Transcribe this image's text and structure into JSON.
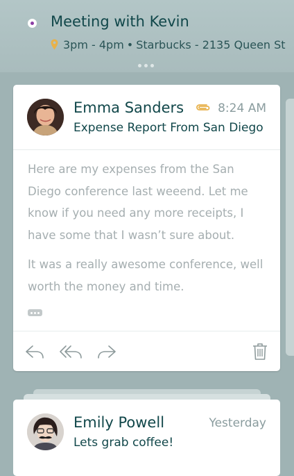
{
  "event": {
    "title": "Meeting with Kevin",
    "time": "3pm - 4pm",
    "location": "Starbucks - 2135 Queen St",
    "status_color": "#8c3ea5"
  },
  "emails": [
    {
      "sender": "Emma Sanders",
      "time": "8:24 AM",
      "subject": "Expense Report From San Diego",
      "has_attachment": true,
      "body": [
        "Here are my expenses from the San Diego conference last weeend. Let me know if you need any more receipts, I have some that I wasn’t sure about.",
        "It was a really awesome conference, well worth the money and time."
      ],
      "actions": [
        "reply-icon",
        "reply-all-icon",
        "forward-icon",
        "trash-icon"
      ]
    },
    {
      "sender": "Emily Powell",
      "time": "Yesterday",
      "subject": "Lets grab coffee!"
    }
  ],
  "colors": {
    "background": "#9fb3b4",
    "title_text": "#11474a",
    "muted_text": "#8a9c9e",
    "body_text": "#a5aeb0",
    "attachment": "#e8b14a"
  }
}
